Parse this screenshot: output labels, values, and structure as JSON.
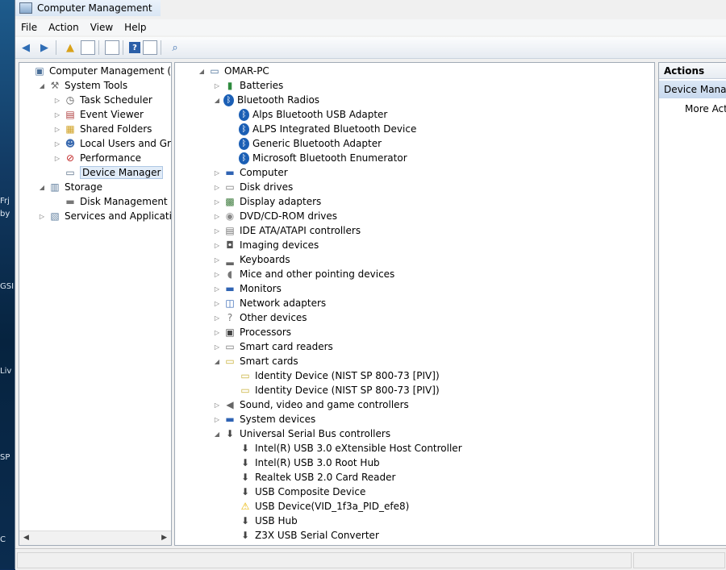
{
  "window": {
    "title": "Computer Management"
  },
  "menu": [
    "File",
    "Action",
    "View",
    "Help"
  ],
  "left_tree": [
    {
      "label": "Computer Management (Local",
      "level": 0,
      "toggle": "",
      "icon": "computer-management-icon"
    },
    {
      "label": "System Tools",
      "level": 1,
      "toggle": "◢",
      "icon": "tools-icon"
    },
    {
      "label": "Task Scheduler",
      "level": 2,
      "toggle": "▷",
      "icon": "clock-icon"
    },
    {
      "label": "Event Viewer",
      "level": 2,
      "toggle": "▷",
      "icon": "event-viewer-icon"
    },
    {
      "label": "Shared Folders",
      "level": 2,
      "toggle": "▷",
      "icon": "shared-folder-icon"
    },
    {
      "label": "Local Users and Groups",
      "level": 2,
      "toggle": "▷",
      "icon": "users-icon"
    },
    {
      "label": "Performance",
      "level": 2,
      "toggle": "▷",
      "icon": "performance-icon"
    },
    {
      "label": "Device Manager",
      "level": 2,
      "toggle": "",
      "icon": "device-manager-icon",
      "selected": true
    },
    {
      "label": "Storage",
      "level": 1,
      "toggle": "◢",
      "icon": "storage-icon"
    },
    {
      "label": "Disk Management",
      "level": 2,
      "toggle": "",
      "icon": "disk-icon"
    },
    {
      "label": "Services and Applications",
      "level": 1,
      "toggle": "▷",
      "icon": "services-icon"
    }
  ],
  "device_tree": [
    {
      "label": "OMAR-PC",
      "level": 0,
      "toggle": "◢",
      "icon": "computer-icon"
    },
    {
      "label": "Batteries",
      "level": 1,
      "toggle": "▷",
      "icon": "battery-icon"
    },
    {
      "label": "Bluetooth Radios",
      "level": 1,
      "toggle": "◢",
      "icon": "bluetooth-icon"
    },
    {
      "label": "Alps Bluetooth USB Adapter",
      "level": 2,
      "toggle": "",
      "icon": "bluetooth-icon"
    },
    {
      "label": "ALPS Integrated Bluetooth Device",
      "level": 2,
      "toggle": "",
      "icon": "bluetooth-icon"
    },
    {
      "label": "Generic Bluetooth Adapter",
      "level": 2,
      "toggle": "",
      "icon": "bluetooth-icon"
    },
    {
      "label": "Microsoft Bluetooth Enumerator",
      "level": 2,
      "toggle": "",
      "icon": "bluetooth-icon"
    },
    {
      "label": "Computer",
      "level": 1,
      "toggle": "▷",
      "icon": "monitor-icon"
    },
    {
      "label": "Disk drives",
      "level": 1,
      "toggle": "▷",
      "icon": "disk-drive-icon"
    },
    {
      "label": "Display adapters",
      "level": 1,
      "toggle": "▷",
      "icon": "display-adapter-icon"
    },
    {
      "label": "DVD/CD-ROM drives",
      "level": 1,
      "toggle": "▷",
      "icon": "dvd-icon"
    },
    {
      "label": "IDE ATA/ATAPI controllers",
      "level": 1,
      "toggle": "▷",
      "icon": "ide-icon"
    },
    {
      "label": "Imaging devices",
      "level": 1,
      "toggle": "▷",
      "icon": "camera-icon"
    },
    {
      "label": "Keyboards",
      "level": 1,
      "toggle": "▷",
      "icon": "keyboard-icon"
    },
    {
      "label": "Mice and other pointing devices",
      "level": 1,
      "toggle": "▷",
      "icon": "mouse-icon"
    },
    {
      "label": "Monitors",
      "level": 1,
      "toggle": "▷",
      "icon": "monitor-icon"
    },
    {
      "label": "Network adapters",
      "level": 1,
      "toggle": "▷",
      "icon": "network-icon"
    },
    {
      "label": "Other devices",
      "level": 1,
      "toggle": "▷",
      "icon": "unknown-device-icon"
    },
    {
      "label": "Processors",
      "level": 1,
      "toggle": "▷",
      "icon": "processor-icon"
    },
    {
      "label": "Smart card readers",
      "level": 1,
      "toggle": "▷",
      "icon": "smart-card-reader-icon"
    },
    {
      "label": "Smart cards",
      "level": 1,
      "toggle": "◢",
      "icon": "smart-card-icon"
    },
    {
      "label": "Identity Device (NIST SP 800-73 [PIV])",
      "level": 2,
      "toggle": "",
      "icon": "smart-card-icon"
    },
    {
      "label": "Identity Device (NIST SP 800-73 [PIV])",
      "level": 2,
      "toggle": "",
      "icon": "smart-card-icon"
    },
    {
      "label": "Sound, video and game controllers",
      "level": 1,
      "toggle": "▷",
      "icon": "speaker-icon"
    },
    {
      "label": "System devices",
      "level": 1,
      "toggle": "▷",
      "icon": "system-device-icon"
    },
    {
      "label": "Universal Serial Bus controllers",
      "level": 1,
      "toggle": "◢",
      "icon": "usb-icon"
    },
    {
      "label": "Intel(R) USB 3.0 eXtensible Host Controller",
      "level": 2,
      "toggle": "",
      "icon": "usb-icon"
    },
    {
      "label": "Intel(R) USB 3.0 Root Hub",
      "level": 2,
      "toggle": "",
      "icon": "usb-icon"
    },
    {
      "label": "Realtek USB 2.0 Card Reader",
      "level": 2,
      "toggle": "",
      "icon": "usb-icon"
    },
    {
      "label": "USB Composite Device",
      "level": 2,
      "toggle": "",
      "icon": "usb-icon"
    },
    {
      "label": "USB Device(VID_1f3a_PID_efe8)",
      "level": 2,
      "toggle": "",
      "icon": "usb-warning-icon"
    },
    {
      "label": "USB Hub",
      "level": 2,
      "toggle": "",
      "icon": "usb-icon"
    },
    {
      "label": "Z3X USB Serial Converter",
      "level": 2,
      "toggle": "",
      "icon": "usb-icon"
    }
  ],
  "actions": {
    "header": "Actions",
    "section": "Device Manag",
    "more": "More Acti"
  },
  "desktop_fragments": [
    "Frj",
    "by",
    "GSI",
    "Liv",
    "SP",
    "C"
  ],
  "colors": {
    "selection": "#e1ecf8",
    "accent": "#14a2d6",
    "bluetooth": "#1b5fb5",
    "warning": "#e8b400"
  }
}
